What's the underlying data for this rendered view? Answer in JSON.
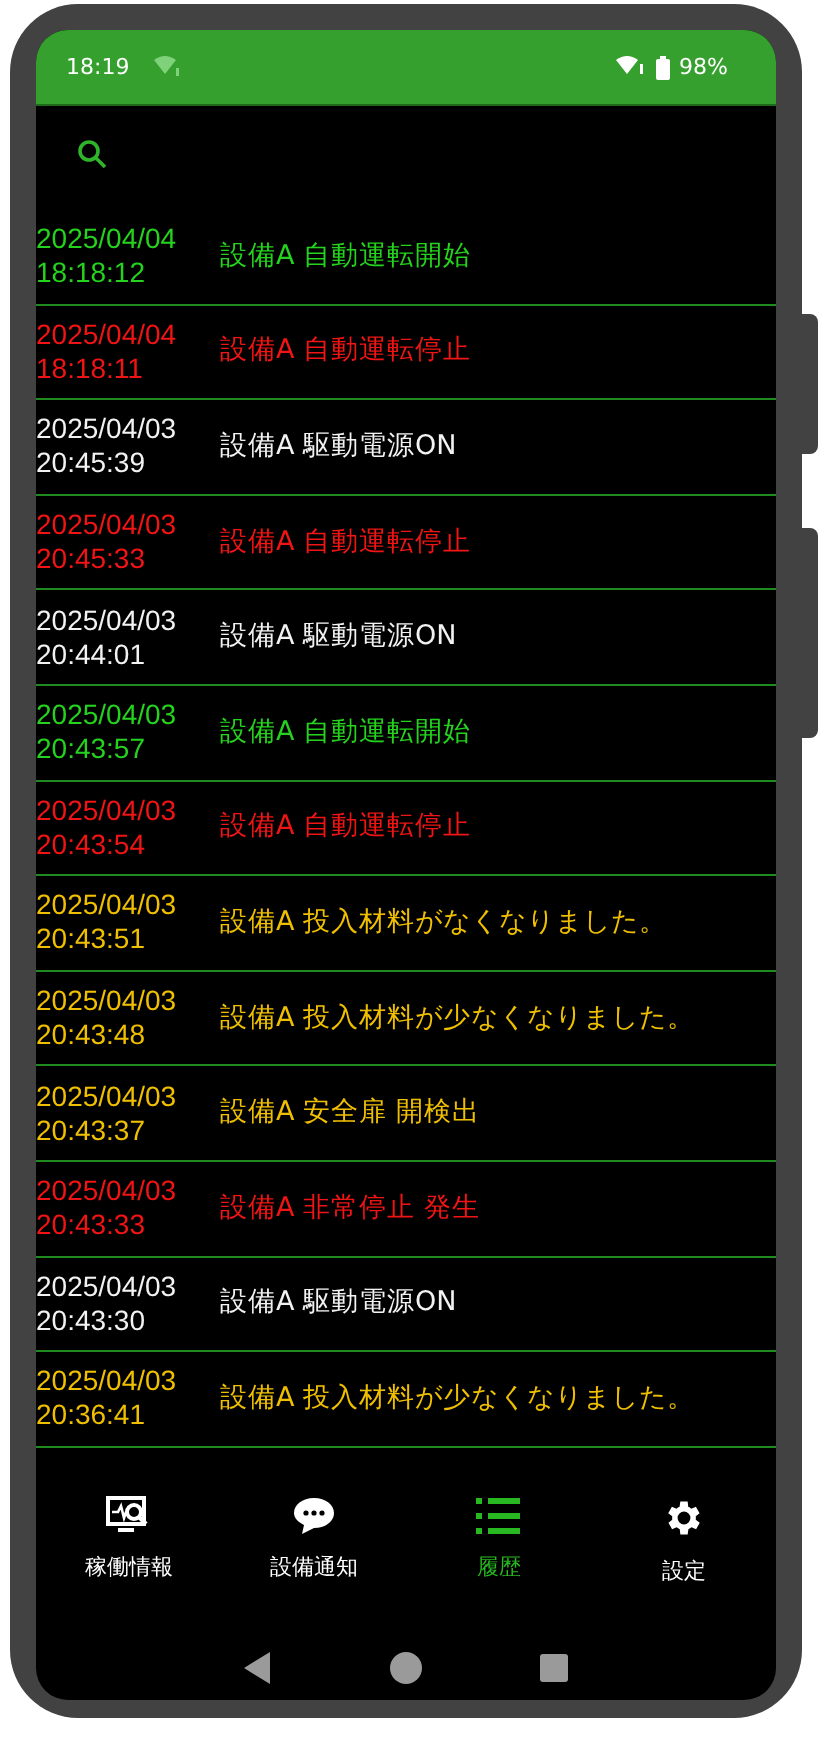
{
  "status_bar": {
    "time": "18:19",
    "battery": "98%"
  },
  "history": [
    {
      "date": "2025/04/04",
      "time": "18:18:12",
      "message": "設備A 自動運転開始",
      "kind": "start"
    },
    {
      "date": "2025/04/04",
      "time": "18:18:11",
      "message": "設備A 自動運転停止",
      "kind": "stop"
    },
    {
      "date": "2025/04/03",
      "time": "20:45:39",
      "message": "設備A 駆動電源ON",
      "kind": "power"
    },
    {
      "date": "2025/04/03",
      "time": "20:45:33",
      "message": "設備A 自動運転停止",
      "kind": "stop"
    },
    {
      "date": "2025/04/03",
      "time": "20:44:01",
      "message": "設備A 駆動電源ON",
      "kind": "power"
    },
    {
      "date": "2025/04/03",
      "time": "20:43:57",
      "message": "設備A 自動運転開始",
      "kind": "start"
    },
    {
      "date": "2025/04/03",
      "time": "20:43:54",
      "message": "設備A 自動運転停止",
      "kind": "stop"
    },
    {
      "date": "2025/04/03",
      "time": "20:43:51",
      "message": "設備A 投入材料がなくなりました。",
      "kind": "warning"
    },
    {
      "date": "2025/04/03",
      "time": "20:43:48",
      "message": "設備A 投入材料が少なくなりました。",
      "kind": "warning"
    },
    {
      "date": "2025/04/03",
      "time": "20:43:37",
      "message": "設備A 安全扉 開検出",
      "kind": "warning"
    },
    {
      "date": "2025/04/03",
      "time": "20:43:33",
      "message": "設備A 非常停止 発生",
      "kind": "stop"
    },
    {
      "date": "2025/04/03",
      "time": "20:43:30",
      "message": "設備A 駆動電源ON",
      "kind": "power"
    },
    {
      "date": "2025/04/03",
      "time": "20:36:41",
      "message": "設備A 投入材料が少なくなりました。",
      "kind": "warning"
    }
  ],
  "bottom_nav": [
    {
      "label": "稼働情報",
      "kind": "monitor",
      "selected": false
    },
    {
      "label": "設備通知",
      "kind": "chat",
      "selected": false
    },
    {
      "label": "履歴",
      "kind": "list",
      "selected": true
    },
    {
      "label": "設定",
      "kind": "gear",
      "selected": false
    }
  ]
}
